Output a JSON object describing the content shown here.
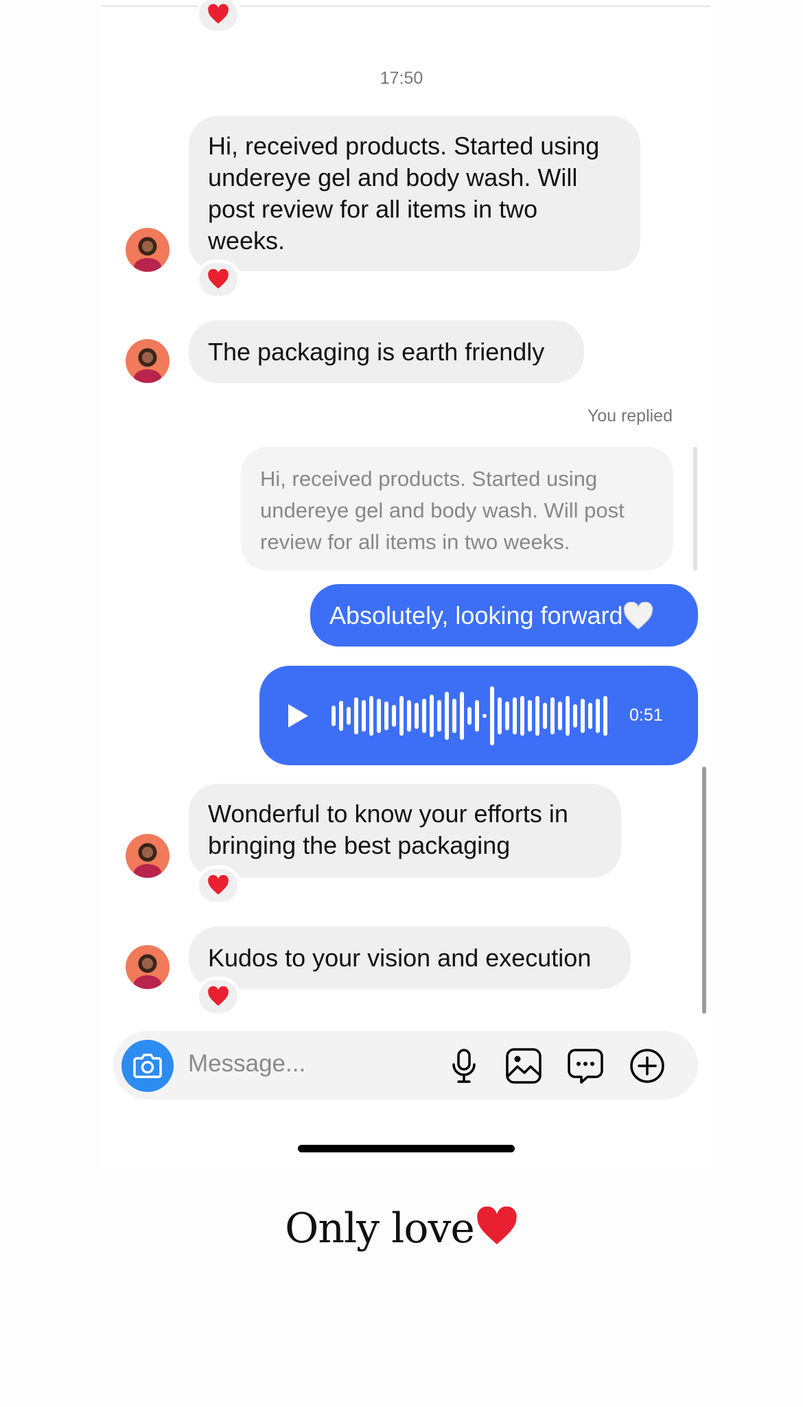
{
  "timestamp": "17:50",
  "messages": [
    {
      "text": "Hi, received products. Started using undereye gel and body wash. Will post review for all items in two weeks.",
      "reaction": "heart"
    },
    {
      "text": "The packaging is earth friendly"
    },
    {
      "text": "Wonderful to know your efforts in bringing the best packaging",
      "reaction": "heart"
    },
    {
      "text": "Kudos to your vision and execution",
      "reaction": "heart"
    }
  ],
  "reply": {
    "label": "You replied",
    "quoted_text": "Hi, received products. Started using undereye gel and body wash. Will post review for all items in two weeks.",
    "text": "Absolutely, looking forward",
    "emoji": "white-heart"
  },
  "voice_message": {
    "duration": "0:51"
  },
  "composer": {
    "placeholder": "Message..."
  },
  "caption": {
    "text": "Only love",
    "emoji": "red-heart"
  },
  "colors": {
    "outgoing_bubble": "#3d6ff6",
    "incoming_bubble": "#efefef",
    "camera_button": "#2d8cf0",
    "reaction_heart": "#e8202f"
  },
  "icons": [
    "camera-icon",
    "microphone-icon",
    "gallery-icon",
    "sticker-icon",
    "plus-icon",
    "play-icon",
    "heart-icon"
  ]
}
